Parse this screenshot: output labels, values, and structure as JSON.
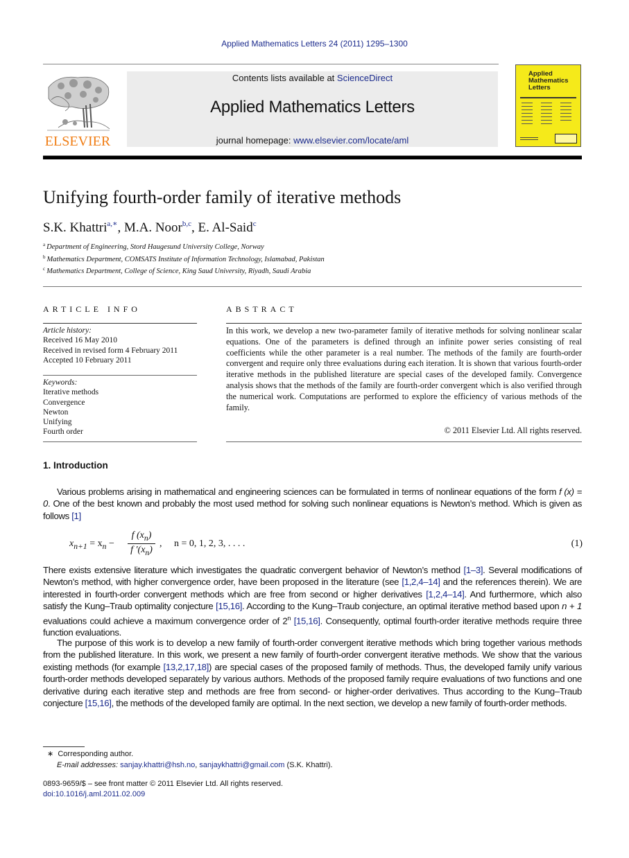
{
  "journal_ref": "Applied Mathematics Letters 24 (2011) 1295–1300",
  "masthead": {
    "contents_prefix": "Contents lists available at ",
    "contents_link": "ScienceDirect",
    "journal_title": "Applied Mathematics Letters",
    "homepage_prefix": "journal homepage: ",
    "homepage_link": "www.elsevier.com/locate/aml",
    "publisher_logo": "ELSEVIER",
    "cover_title_lines": [
      "Applied",
      "Mathematics",
      "Letters"
    ],
    "brand_color": "#f07d14",
    "cover_color": "#f5ea1a",
    "link_color": "#1a2a8c"
  },
  "article": {
    "title": "Unifying fourth-order family of iterative methods",
    "authors": [
      {
        "name": "S.K. Khattri",
        "sup": "a,∗"
      },
      {
        "name": "M.A. Noor",
        "sup": "b,c"
      },
      {
        "name": "E. Al-Said",
        "sup": "c"
      }
    ],
    "affiliations": [
      {
        "mark": "a",
        "text": "Department of Engineering, Stord Haugesund University College, Norway"
      },
      {
        "mark": "b",
        "text": "Mathematics Department, COMSATS Institute of Information Technology, Islamabad, Pakistan"
      },
      {
        "mark": "c",
        "text": "Mathematics Department, College of Science, King Saud University, Riyadh, Saudi Arabia"
      }
    ]
  },
  "article_info": {
    "heading": "ARTICLE INFO",
    "history_label": "Article history:",
    "history": [
      "Received 16 May 2010",
      "Received in revised form 4 February 2011",
      "Accepted 10 February 2011"
    ],
    "keywords_label": "Keywords:",
    "keywords": [
      "Iterative methods",
      "Convergence",
      "Newton",
      "Unifying",
      "Fourth order"
    ]
  },
  "abstract": {
    "heading": "ABSTRACT",
    "text": "In this work, we develop a new two-parameter family of iterative methods for solving nonlinear scalar equations. One of the parameters is defined through an infinite power series consisting of real coefficients while the other parameter is a real number. The methods of the family are fourth-order convergent and require only three evaluations during each iteration. It is shown that various fourth-order iterative methods in the published literature are special cases of the developed family. Convergence analysis shows that the methods of the family are fourth-order convergent which is also verified through the numerical work. Computations are performed to explore the efficiency of various methods of the family.",
    "copyright": "© 2011 Elsevier Ltd. All rights reserved."
  },
  "section": {
    "heading": "1.  Introduction",
    "p1": [
      "Various problems arising in mathematical and engineering sciences can be formulated in terms of nonlinear equations of the form ",
      "f (x) = 0",
      ". One of the best known and probably the most used method for solving such nonlinear equations is Newton’s method. Which is given as follows ",
      "[1]"
    ],
    "equation": {
      "lhs": "x",
      "lhs_sub": "n+1",
      "mid": " = x",
      "mid_sub": "n",
      "minus": " − ",
      "num": "f (x",
      "num_sub": "n",
      "den": "f ′(x",
      "den_sub": "n",
      "rest": ",     n = 0, 1, 2, 3, . . . .",
      "number": "(1)"
    },
    "p2": [
      "There exists extensive literature which investigates the quadratic convergent behavior of Newton’s method ",
      "[1–3]",
      ". Several modifications of Newton’s method, with higher convergence order, have been proposed in the literature (see ",
      "[1,2,4–14]",
      " and the references therein). We are interested in fourth-order convergent methods which are free from second or higher derivatives ",
      "[1,2,4–14]",
      ". And furthermore, which also satisfy the Kung–Traub optimality conjecture ",
      "[15,16]",
      ". According to the Kung–Traub conjecture, an optimal iterative method based upon ",
      "n + 1",
      " evaluations could achieve a maximum convergence order of 2",
      "n",
      " ",
      "[15,16]",
      ". Consequently, optimal fourth-order iterative methods require three function evaluations."
    ],
    "p3": [
      "The purpose of this work is to develop a new family of fourth-order convergent iterative methods which bring together various methods from the published literature. In this work, we present a new family of fourth-order convergent iterative methods. We show that the various existing methods (for example ",
      "[13,2,17,18]",
      ") are special cases of the proposed family of methods. Thus, the developed family unify various fourth-order methods developed separately by various authors. Methods of the proposed family require evaluations of two functions and one derivative during each iterative step and methods are free from second- or higher-order derivatives. Thus according to the Kung–Traub conjecture ",
      "[15,16]",
      ", the methods of the developed family are optimal. In the next section, we develop a new family of fourth-order methods."
    ]
  },
  "footnotes": {
    "mark": "∗",
    "corresponding": "Corresponding author.",
    "email_label": "E-mail addresses:",
    "email1": "sanjay.khattri@hsh.no",
    "email2": "sanjaykhattri@gmail.com",
    "email_owner": " (S.K. Khattri).",
    "issn_line": "0893-9659/$ – see front matter © 2011 Elsevier Ltd. All rights reserved.",
    "doi": "doi:10.1016/j.aml.2011.02.009"
  }
}
